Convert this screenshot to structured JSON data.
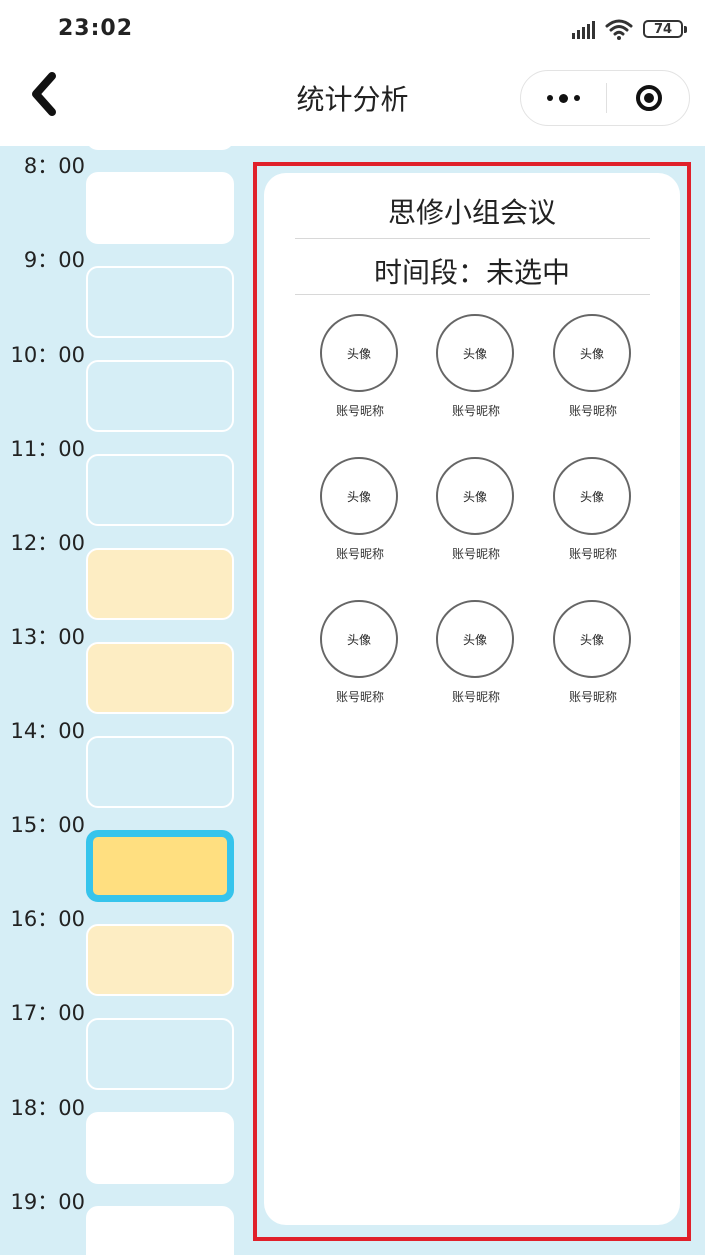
{
  "status_bar": {
    "time": "23:02",
    "battery": "74"
  },
  "nav": {
    "title": "统计分析"
  },
  "schedule": {
    "hours": [
      "8：00",
      "9：00",
      "10：00",
      "11：00",
      "12：00",
      "13：00",
      "14：00",
      "15：00",
      "16：00",
      "17：00",
      "18：00",
      "19：00"
    ],
    "slot_states": [
      "free",
      "free",
      "empty",
      "empty",
      "empty",
      "busy",
      "busy",
      "empty",
      "selected",
      "busy",
      "empty",
      "free",
      "free"
    ]
  },
  "panel": {
    "meeting_title": "思修小组会议",
    "period": "时间段：未选中",
    "members": [
      {
        "avatar": "头像",
        "nickname": "账号昵称"
      },
      {
        "avatar": "头像",
        "nickname": "账号昵称"
      },
      {
        "avatar": "头像",
        "nickname": "账号昵称"
      },
      {
        "avatar": "头像",
        "nickname": "账号昵称"
      },
      {
        "avatar": "头像",
        "nickname": "账号昵称"
      },
      {
        "avatar": "头像",
        "nickname": "账号昵称"
      },
      {
        "avatar": "头像",
        "nickname": "账号昵称"
      },
      {
        "avatar": "头像",
        "nickname": "账号昵称"
      },
      {
        "avatar": "头像",
        "nickname": "账号昵称"
      }
    ]
  },
  "colors": {
    "background": "#d6eef6",
    "busy_slot": "#fdedc3",
    "selected_slot": "#ffdf80",
    "selected_border": "#36c4ec",
    "highlight_outline": "#e0202a"
  }
}
